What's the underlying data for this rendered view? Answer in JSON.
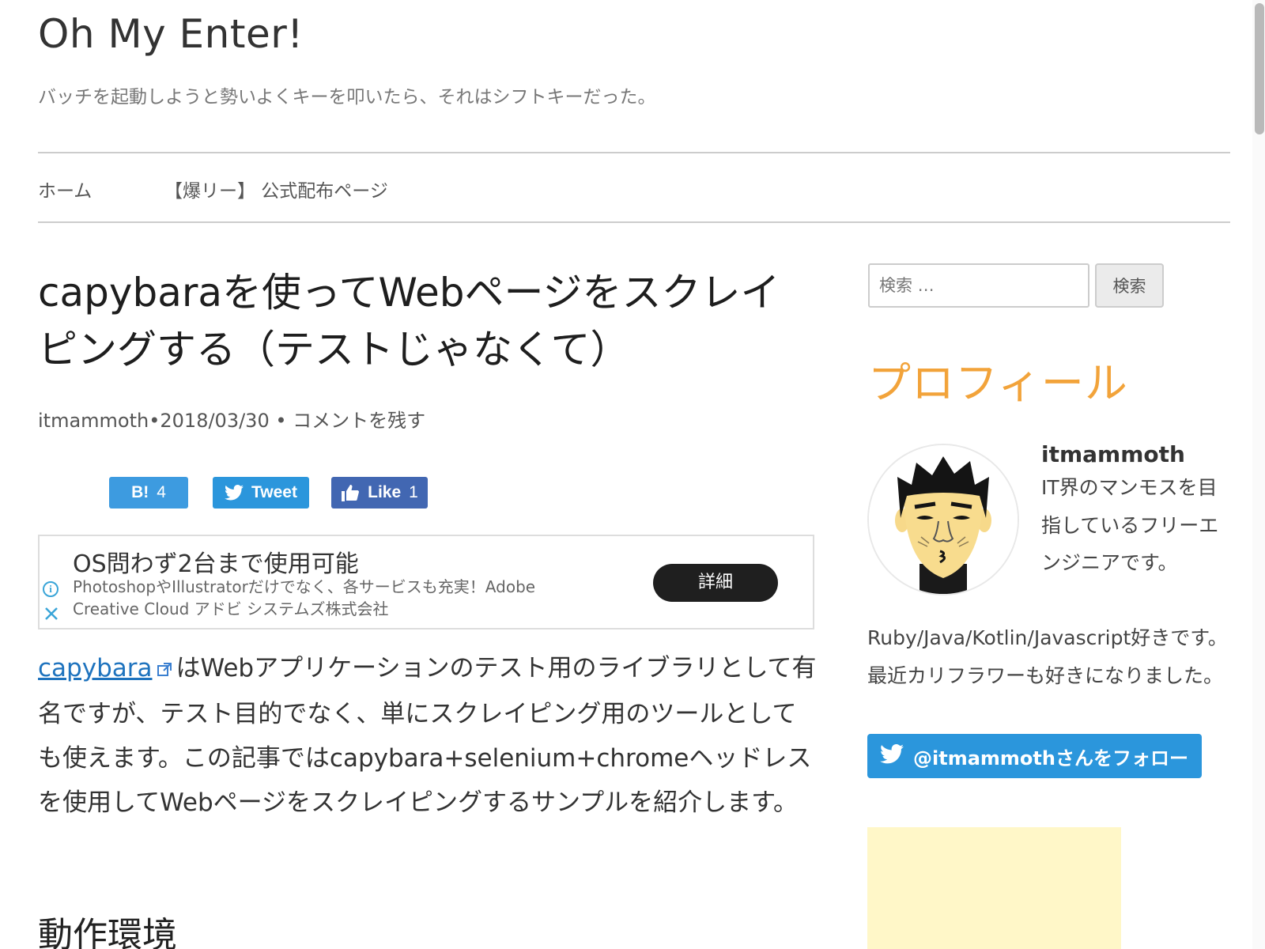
{
  "site": {
    "title": "Oh My Enter!",
    "description": "バッチを起動しようと勢いよくキーを叩いたら、それはシフトキーだった。"
  },
  "nav": {
    "items": [
      {
        "label": "ホーム"
      },
      {
        "label": "【爆リー】 公式配布ページ"
      }
    ]
  },
  "post": {
    "title": "capybaraを使ってWebページをスクレイピングする（テストじゃなくて）",
    "meta": {
      "author": "itmammoth",
      "separator": "•",
      "date": "2018/03/30",
      "separator2": " • ",
      "comment_link": "コメントを残す"
    },
    "share": {
      "hatena_label": "B!",
      "hatena_count": "4",
      "tweet_label": "Tweet",
      "like_label": "Like",
      "like_count": "1"
    },
    "body": {
      "link_text": "capybara",
      "text": "はWebアプリケーションのテスト用のライブラリとして有名ですが、テスト目的でなく、単にスクレイピング用のツールとしても使えます。この記事ではcapybara+selenium+chromeヘッドレスを使用してWebページをスクレイピングするサンプルを紹介します。"
    },
    "section_heading": "動作環境"
  },
  "ad": {
    "title": "OS問わず2台まで使用可能",
    "body": "PhotoshopやIllustratorだけでなく、各サービスも充実！Adobe Creative Cloud アドビ システムズ株式会社",
    "button_label": "詳細"
  },
  "sidebar": {
    "search": {
      "placeholder": "検索 …",
      "value": "",
      "button_label": "検索"
    },
    "profile": {
      "heading": "プロフィール",
      "name": "itmammoth",
      "bio": "IT界のマンモスを目指しているフリーエンジニアです。 Ruby/Java/Kotlin/Javascript好きです。 最近カリフラワーも好きになりました。"
    },
    "follow_button": "@itmammothさんをフォロー"
  },
  "colors": {
    "accent": "#f2a33a",
    "link": "#1e73be",
    "twitter": "#2b96dc",
    "facebook": "#4267b2",
    "hatena": "#3d9be0",
    "ad_placeholder": "#fff7c8"
  },
  "icons": {
    "external_link": "external-link-icon",
    "twitter": "twitter-bird-icon",
    "facebook_like": "thumbs-up-icon",
    "ad_info": "info-icon",
    "ad_close": "close-icon"
  }
}
